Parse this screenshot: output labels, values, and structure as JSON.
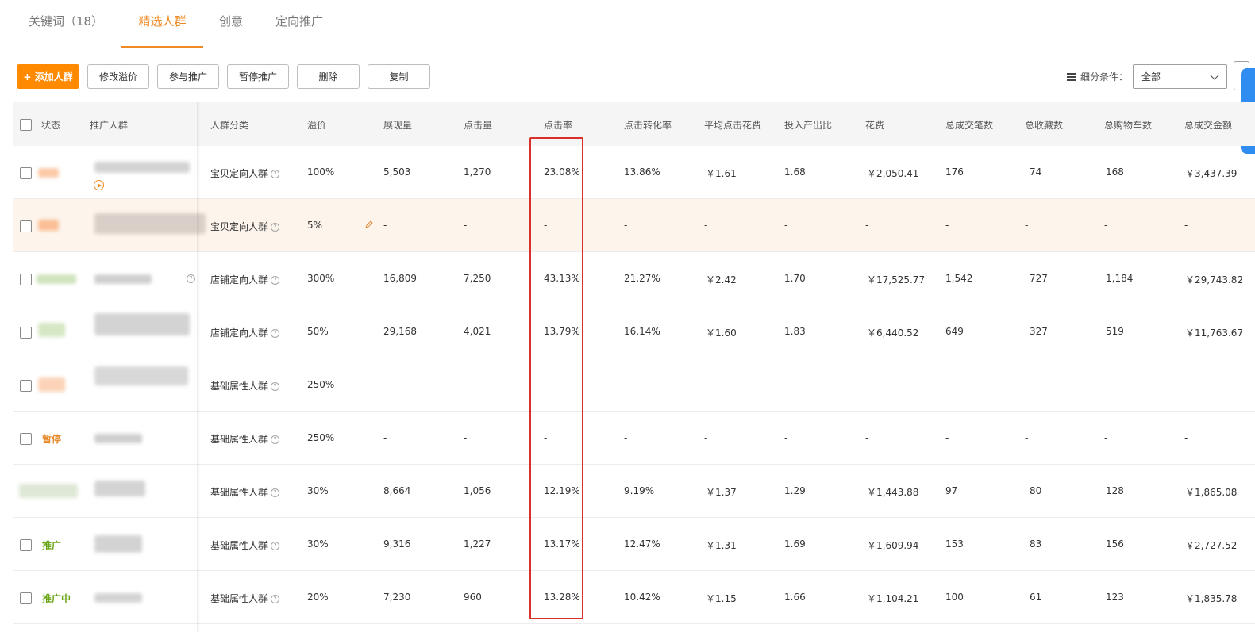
{
  "tabs": [
    {
      "label": "关键词（18）",
      "active": false
    },
    {
      "label": "精选人群",
      "active": true
    },
    {
      "label": "创意",
      "active": false
    },
    {
      "label": "定向推广",
      "active": false
    }
  ],
  "toolbar": {
    "add_label": "+ 添加人群",
    "modify_premium_label": "修改溢价",
    "join_label": "参与推广",
    "pause_label": "暂停推广",
    "delete_label": "删除",
    "copy_label": "复制"
  },
  "filter": {
    "label": "细分条件：",
    "selected": "全部"
  },
  "columns": {
    "status": "状态",
    "crowd": "推广人群",
    "category": "人群分类",
    "premium": "溢价",
    "impressions": "展现量",
    "clicks": "点击量",
    "ctr": "点击率",
    "cvr": "点击转化率",
    "avg_cpc": "平均点击花费",
    "roi": "投入产出比",
    "cost": "花费",
    "orders": "总成交笔数",
    "favorites": "总收藏数",
    "carts": "总购物车数",
    "gmv": "总成交金额"
  },
  "rows": [
    {
      "status": "",
      "category": "宝贝定向人群",
      "premium": "100%",
      "impressions": "5,503",
      "clicks": "1,270",
      "ctr": "23.08%",
      "cvr": "13.86%",
      "avg_cpc": "￥1.61",
      "roi": "1.68",
      "cost": "￥2,050.41",
      "orders": "176",
      "favorites": "74",
      "carts": "168",
      "gmv": "￥3,437.39"
    },
    {
      "status": "",
      "category": "宝贝定向人群",
      "premium": "5%",
      "impressions": "-",
      "clicks": "-",
      "ctr": "-",
      "cvr": "-",
      "avg_cpc": "-",
      "roi": "-",
      "cost": "-",
      "orders": "-",
      "favorites": "-",
      "carts": "-",
      "gmv": "-"
    },
    {
      "status": "",
      "category": "店铺定向人群",
      "premium": "300%",
      "impressions": "16,809",
      "clicks": "7,250",
      "ctr": "43.13%",
      "cvr": "21.27%",
      "avg_cpc": "￥2.42",
      "roi": "1.70",
      "cost": "￥17,525.77",
      "orders": "1,542",
      "favorites": "727",
      "carts": "1,184",
      "gmv": "￥29,743.82"
    },
    {
      "status": "",
      "category": "店铺定向人群",
      "premium": "50%",
      "impressions": "29,168",
      "clicks": "4,021",
      "ctr": "13.79%",
      "cvr": "16.14%",
      "avg_cpc": "￥1.60",
      "roi": "1.83",
      "cost": "￥6,440.52",
      "orders": "649",
      "favorites": "327",
      "carts": "519",
      "gmv": "￥11,763.67"
    },
    {
      "status": "",
      "category": "基础属性人群",
      "premium": "250%",
      "impressions": "-",
      "clicks": "-",
      "ctr": "-",
      "cvr": "-",
      "avg_cpc": "-",
      "roi": "-",
      "cost": "-",
      "orders": "-",
      "favorites": "-",
      "carts": "-",
      "gmv": "-"
    },
    {
      "status": "暂停",
      "category": "基础属性人群",
      "premium": "250%",
      "impressions": "-",
      "clicks": "-",
      "ctr": "-",
      "cvr": "-",
      "avg_cpc": "-",
      "roi": "-",
      "cost": "-",
      "orders": "-",
      "favorites": "-",
      "carts": "-",
      "gmv": "-"
    },
    {
      "status": "",
      "category": "基础属性人群",
      "premium": "30%",
      "impressions": "8,664",
      "clicks": "1,056",
      "ctr": "12.19%",
      "cvr": "9.19%",
      "avg_cpc": "￥1.37",
      "roi": "1.29",
      "cost": "￥1,443.88",
      "orders": "97",
      "favorites": "80",
      "carts": "128",
      "gmv": "￥1,865.08"
    },
    {
      "status": "推广",
      "category": "基础属性人群",
      "premium": "30%",
      "impressions": "9,316",
      "clicks": "1,227",
      "ctr": "13.17%",
      "cvr": "12.47%",
      "avg_cpc": "￥1.31",
      "roi": "1.69",
      "cost": "￥1,609.94",
      "orders": "153",
      "favorites": "83",
      "carts": "156",
      "gmv": "￥2,727.52"
    },
    {
      "status": "推广中",
      "category": "基础属性人群",
      "premium": "20%",
      "impressions": "7,230",
      "clicks": "960",
      "ctr": "13.28%",
      "cvr": "10.42%",
      "avg_cpc": "￥1.15",
      "roi": "1.66",
      "cost": "￥1,104.21",
      "orders": "100",
      "favorites": "61",
      "carts": "123",
      "gmv": "￥1,835.78"
    }
  ],
  "colors": {
    "accent": "#f08a24",
    "primary_button": "#ff8a00",
    "highlight_row": "#fdf4ec",
    "annotation_box": "#d9302c",
    "status_paused": "#e8892b",
    "status_active": "#6aa517"
  },
  "icons": [
    "list-icon",
    "chevron-down-icon",
    "help-icon",
    "pencil-icon",
    "play-circle-icon"
  ]
}
